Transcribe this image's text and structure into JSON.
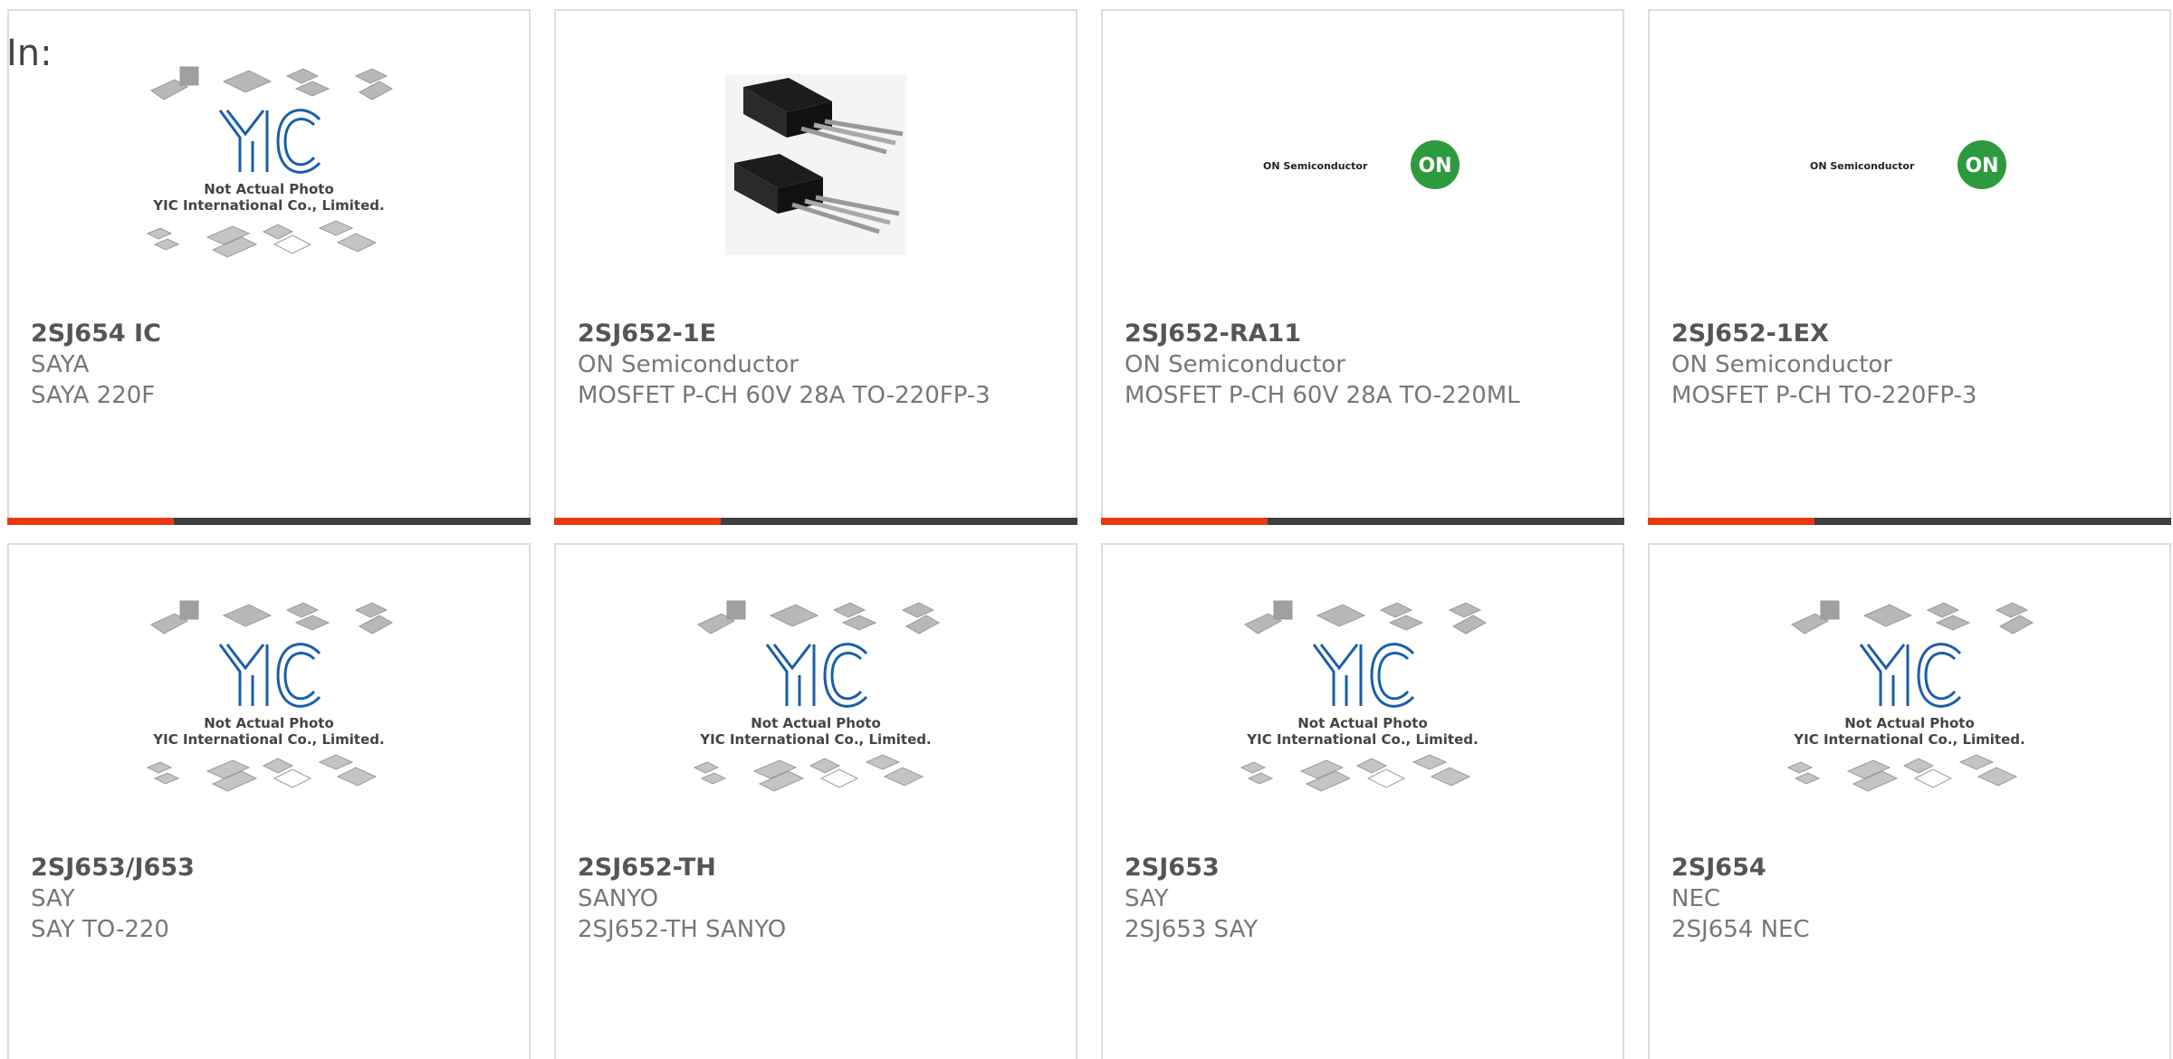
{
  "page": {
    "in_label": "In:"
  },
  "cards": [
    {
      "part": "2SJ654 IC",
      "manufacturer": "SAYA",
      "description": "SAYA 220F",
      "image": "yic-placeholder",
      "placeholder": {
        "brand": "YIC",
        "note": "Not Actual Photo",
        "company": "YIC International Co., Limited."
      }
    },
    {
      "part": "2SJ652-1E",
      "manufacturer": "ON Semiconductor",
      "description": "MOSFET P-CH 60V 28A TO-220FP-3",
      "image": "to220-transistor-photo"
    },
    {
      "part": "2SJ652-RA11",
      "manufacturer": "ON Semiconductor",
      "description": "MOSFET P-CH 60V 28A TO-220ML",
      "image": "on-semiconductor-logo",
      "logo": {
        "wordmark": "ON Semiconductor",
        "badge": "ON"
      }
    },
    {
      "part": "2SJ652-1EX",
      "manufacturer": "ON Semiconductor",
      "description": "MOSFET P-CH TO-220FP-3",
      "image": "on-semiconductor-logo",
      "logo": {
        "wordmark": "ON Semiconductor",
        "badge": "ON"
      }
    },
    {
      "part": "2SJ653/J653",
      "manufacturer": "SAY",
      "description": "SAY TO-220",
      "image": "yic-placeholder",
      "placeholder": {
        "brand": "YIC",
        "note": "Not Actual Photo",
        "company": "YIC International Co., Limited."
      }
    },
    {
      "part": "2SJ652-TH",
      "manufacturer": "SANYO",
      "description": "2SJ652-TH SANYO",
      "image": "yic-placeholder",
      "placeholder": {
        "brand": "YIC",
        "note": "Not Actual Photo",
        "company": "YIC International Co., Limited."
      }
    },
    {
      "part": "2SJ653",
      "manufacturer": "SAY",
      "description": "2SJ653 SAY",
      "image": "yic-placeholder",
      "placeholder": {
        "brand": "YIC",
        "note": "Not Actual Photo",
        "company": "YIC International Co., Limited."
      }
    },
    {
      "part": "2SJ654",
      "manufacturer": "NEC",
      "description": "2SJ654 NEC",
      "image": "yic-placeholder",
      "placeholder": {
        "brand": "YIC",
        "note": "Not Actual Photo",
        "company": "YIC International Co., Limited."
      }
    }
  ],
  "colors": {
    "accent": "#e83a12",
    "bar": "#3f3f3f",
    "on_green": "#2e9a3e",
    "yic_blue": "#1a5fa8"
  }
}
